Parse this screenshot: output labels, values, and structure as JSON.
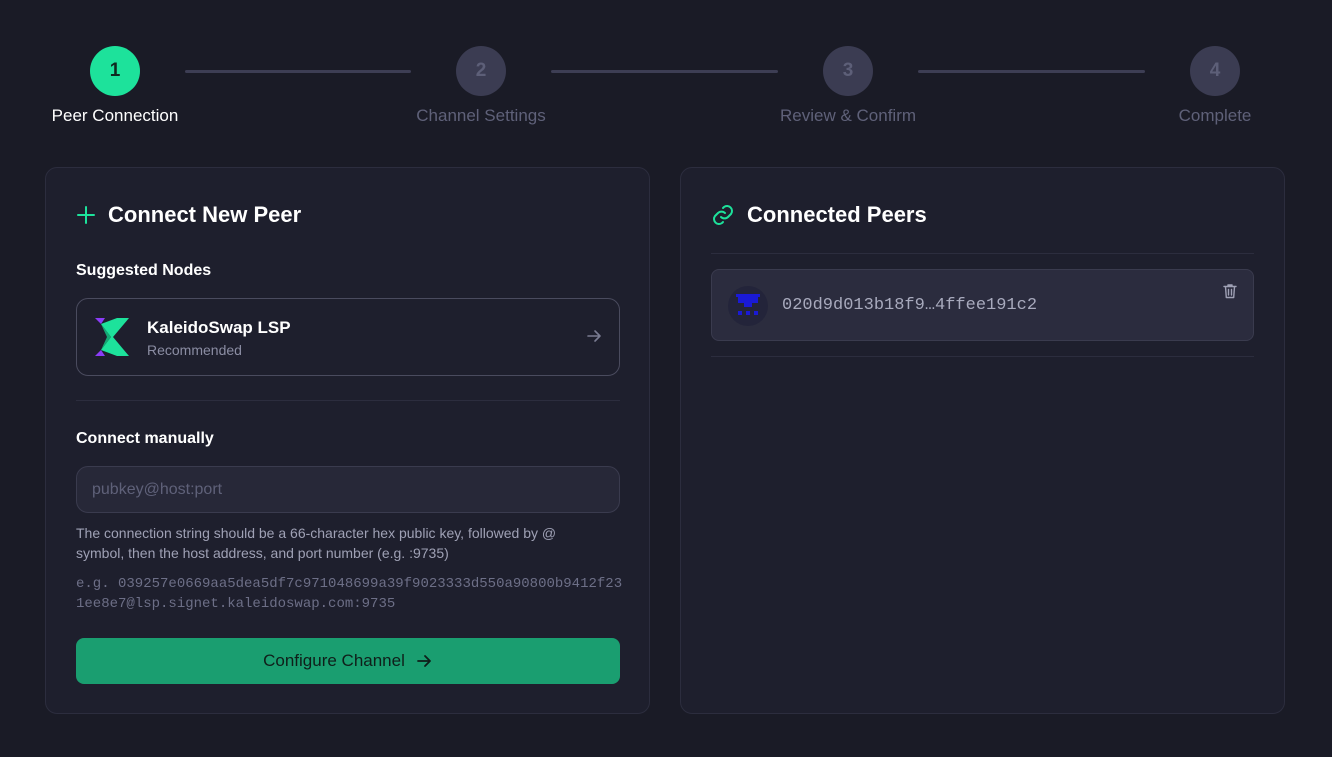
{
  "stepper": {
    "steps": [
      {
        "number": "1",
        "label": "Peer Connection",
        "state": "active"
      },
      {
        "number": "2",
        "label": "Channel Settings",
        "state": "inactive"
      },
      {
        "number": "3",
        "label": "Review & Confirm",
        "state": "inactive"
      },
      {
        "number": "4",
        "label": "Complete",
        "state": "inactive"
      }
    ]
  },
  "connect_card": {
    "title": "Connect New Peer",
    "title_icon": "plus-icon",
    "suggested_label": "Suggested Nodes",
    "suggested_node": {
      "name": "KaleidoSwap LSP",
      "subtitle": "Recommended",
      "icon": "kaleidoswap-logo"
    },
    "manual_label": "Connect manually",
    "input": {
      "value": "",
      "placeholder": "pubkey@host:port"
    },
    "hint": "The connection string should be a 66-character hex public key, followed by @ symbol, then the host address, and port number (e.g. :9735)",
    "example": "e.g. 039257e0669aa5dea5df7c971048699a39f9023333d550a90800b9412f231ee8e7@lsp.signet.kaleidoswap.com:9735",
    "button_label": "Configure Channel"
  },
  "peers_card": {
    "title": "Connected Peers",
    "title_icon": "link-icon",
    "peers": [
      {
        "pubkey": "020d9d013b18f9…4ffee191c2",
        "avatar": "identicon"
      }
    ]
  },
  "colors": {
    "background": "#1a1b26",
    "card": "#1e1f2d",
    "accent": "#1de29b",
    "button": "#1a9e70"
  }
}
